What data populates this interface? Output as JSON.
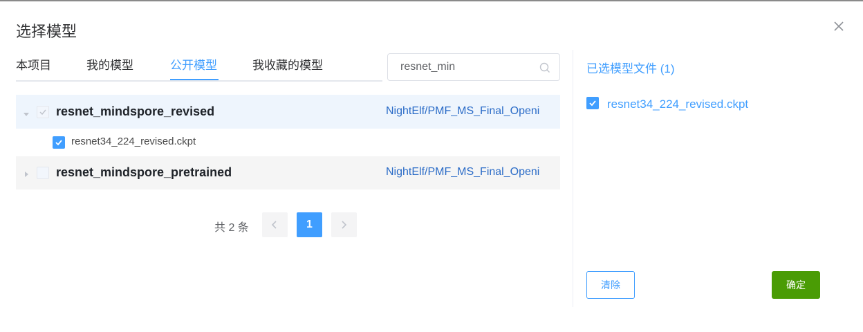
{
  "dialog": {
    "title": "选择模型",
    "close_icon": "close-icon"
  },
  "tabs": [
    {
      "label": "本项目",
      "active": false
    },
    {
      "label": "我的模型",
      "active": false
    },
    {
      "label": "公开模型",
      "active": true
    },
    {
      "label": "我收藏的模型",
      "active": false
    }
  ],
  "search": {
    "value": "resnet_min",
    "icon": "search-icon"
  },
  "models": [
    {
      "name": "resnet_mindspore_revised",
      "owner": "NightElf/PMF_MS_Final_Openi",
      "expanded": true,
      "files": [
        {
          "name": "resnet34_224_revised.ckpt",
          "checked": true
        }
      ]
    },
    {
      "name": "resnet_mindspore_pretrained",
      "owner": "NightElf/PMF_MS_Final_Openi",
      "expanded": false,
      "files": []
    }
  ],
  "pagination": {
    "total_text": "共 2 条",
    "current_page": "1"
  },
  "selected": {
    "title": "已选模型文件 (1)",
    "files": [
      {
        "name": "resnet34_224_revised.ckpt",
        "checked": true
      }
    ]
  },
  "buttons": {
    "clear": "清除",
    "confirm": "确定"
  },
  "colors": {
    "accent": "#409eff",
    "confirm": "#4a9c05",
    "owner_link": "#2a6bc7"
  }
}
